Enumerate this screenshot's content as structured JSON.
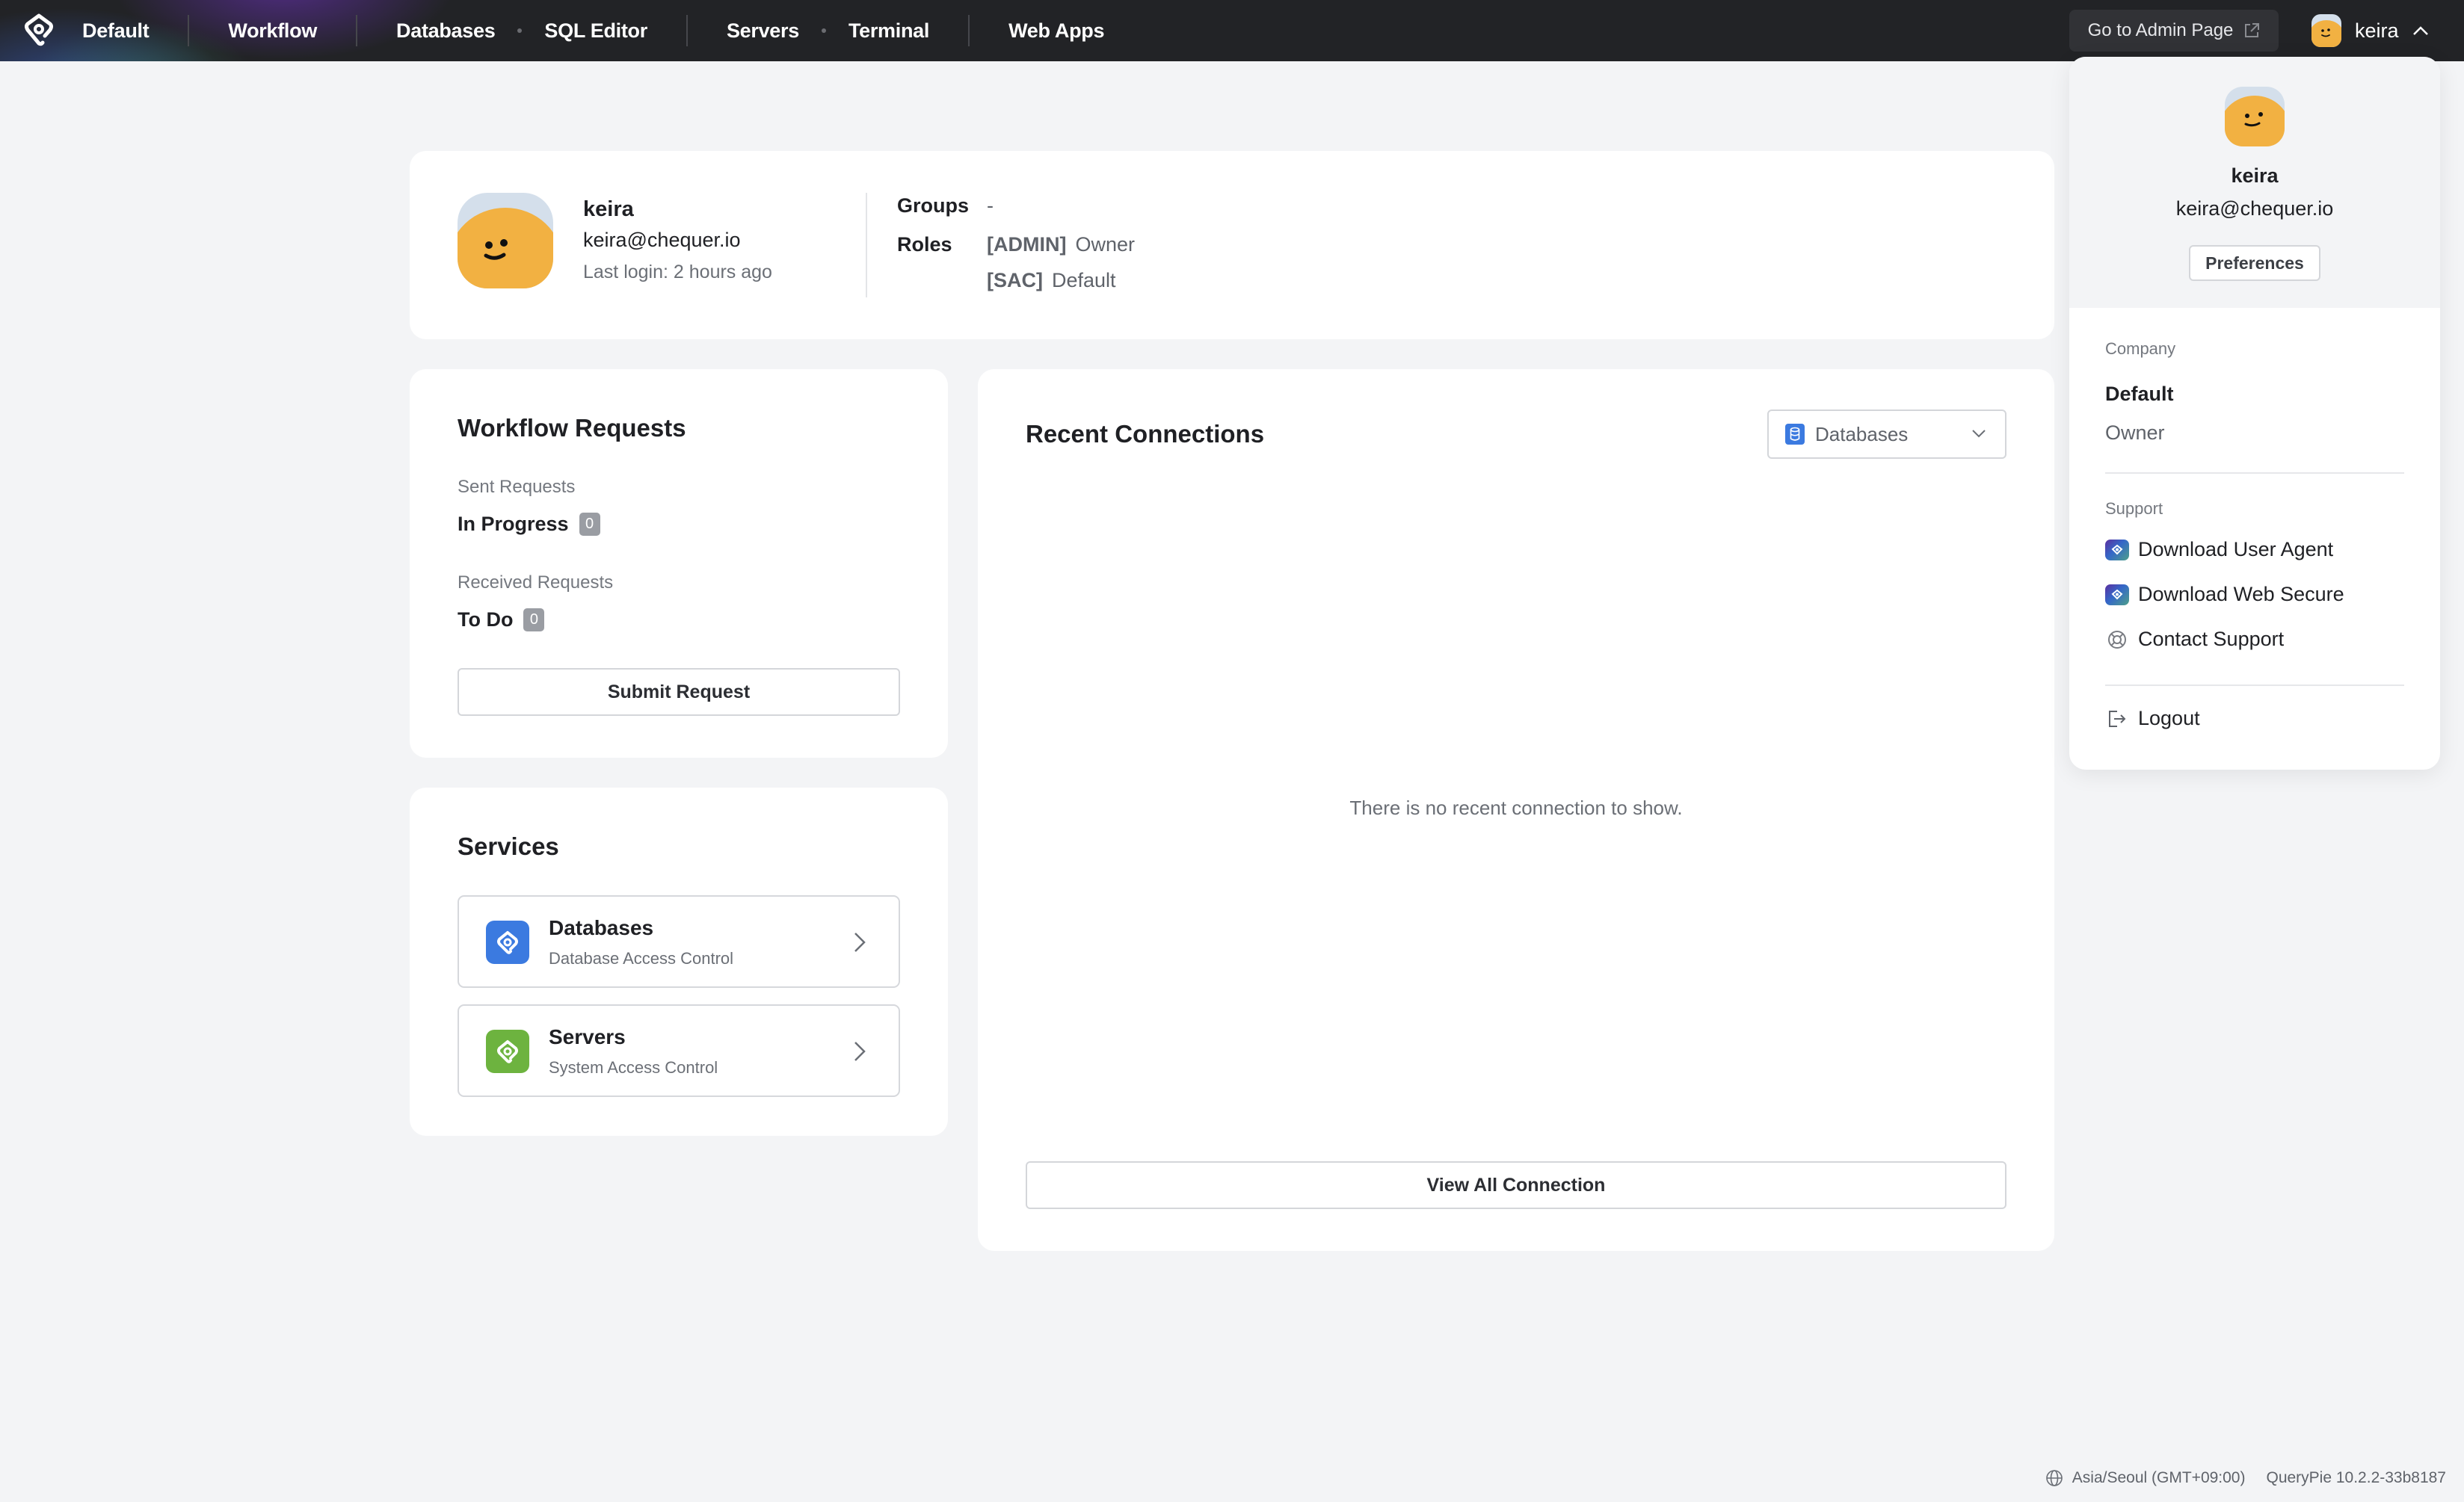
{
  "topbar": {
    "workspace": "Default",
    "nav": [
      "Workflow",
      "Databases",
      "SQL Editor",
      "Servers",
      "Terminal",
      "Web Apps"
    ],
    "admin_button": "Go to Admin Page",
    "username": "keira"
  },
  "profile": {
    "name": "keira",
    "email": "keira@chequer.io",
    "last_login": "Last login: 2 hours ago",
    "groups_label": "Groups",
    "groups_value": "-",
    "roles_label": "Roles",
    "roles": [
      {
        "tag": "[ADMIN]",
        "name": "Owner"
      },
      {
        "tag": "[SAC]",
        "name": "Default"
      }
    ]
  },
  "workflow": {
    "title": "Workflow Requests",
    "sent_label": "Sent Requests",
    "sent_status": "In Progress",
    "sent_count": "0",
    "received_label": "Received Requests",
    "received_status": "To Do",
    "received_count": "0",
    "submit_button": "Submit Request"
  },
  "services": {
    "title": "Services",
    "items": [
      {
        "name": "Databases",
        "desc": "Database Access Control",
        "color": "#3b7ae0"
      },
      {
        "name": "Servers",
        "desc": "System Access Control",
        "color": "#6db33f"
      }
    ]
  },
  "recent": {
    "title": "Recent Connections",
    "filter_selected": "Databases",
    "empty_message": "There is no recent connection to show.",
    "view_all_button": "View All Connection"
  },
  "user_menu": {
    "name": "keira",
    "email": "keira@chequer.io",
    "preferences_button": "Preferences",
    "company_label": "Company",
    "company_name": "Default",
    "company_role": "Owner",
    "support_label": "Support",
    "support_items": [
      "Download User Agent",
      "Download Web Secure",
      "Contact Support"
    ],
    "logout": "Logout"
  },
  "footer": {
    "timezone": "Asia/Seoul (GMT+09:00)",
    "version": "QueryPie 10.2.2-33b8187"
  },
  "colors": {
    "topbar_bg": "#222326",
    "avatar_yellow": "#f2b142",
    "db_blue": "#3b7ae0",
    "server_green": "#6db33f"
  }
}
